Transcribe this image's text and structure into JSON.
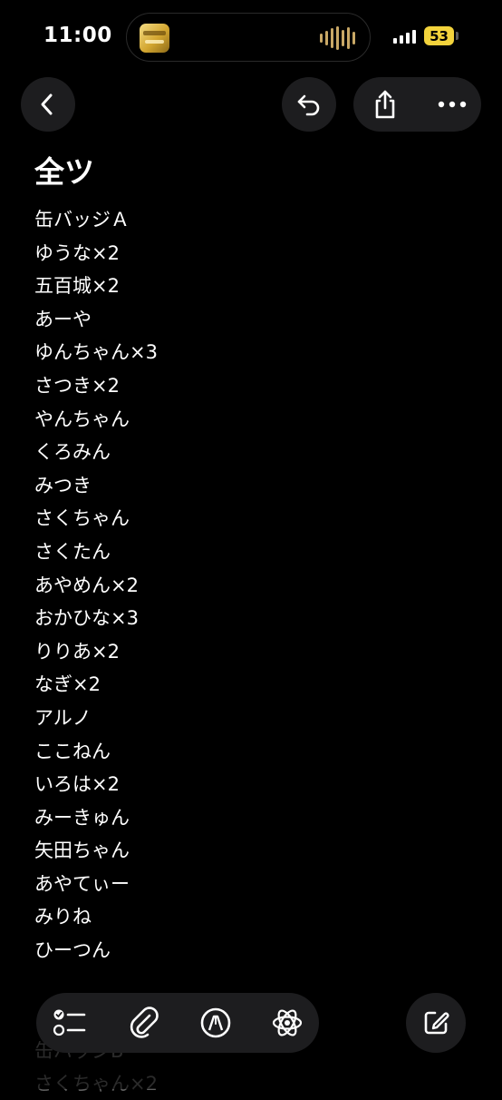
{
  "status_bar": {
    "time": "11:00",
    "battery": "53"
  },
  "icons": {
    "back": "chevron-left-icon",
    "undo": "undo-icon",
    "share": "share-icon",
    "more": "ellipsis-icon",
    "checklist": "checklist-icon",
    "attach": "paperclip-icon",
    "markup": "pen-tip-icon",
    "ai": "apple-intelligence-icon",
    "compose": "compose-icon"
  },
  "note": {
    "title": "全ツ",
    "lines": [
      "缶バッジＡ",
      "ゆうな×2",
      "五百城×2",
      "あーや",
      "ゆんちゃん×3",
      "さつき×2",
      "やんちゃん",
      "くろみん",
      "みつき",
      "さくちゃん",
      "さくたん",
      "あやめん×2",
      "おかひな×3",
      "りりあ×2",
      "なぎ×2",
      "アルノ",
      "ここねん",
      "いろは×2",
      "みーきゅん",
      "矢田ちゃん",
      "あやてぃー",
      "みりね",
      "ひーつん"
    ],
    "tail_lines": [
      "缶バッジB",
      "さくちゃん×2"
    ]
  },
  "colors": {
    "background": "#000000",
    "text": "#ffffff",
    "button_background": "#1d1d1f",
    "battery": "#f3d33c",
    "faded_text": "#5e5e5e"
  }
}
